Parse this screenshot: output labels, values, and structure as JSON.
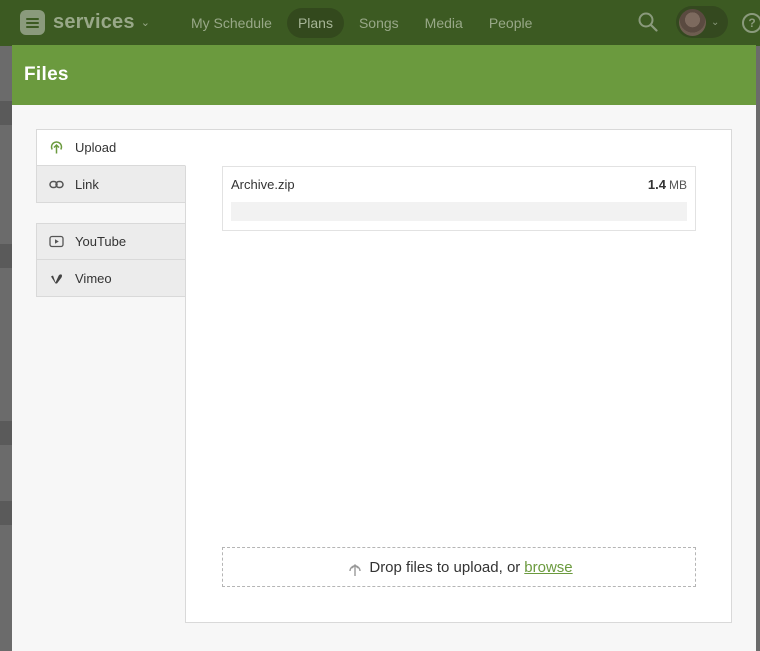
{
  "app": {
    "name": "services",
    "nav": [
      "My Schedule",
      "Plans",
      "Songs",
      "Media",
      "People"
    ],
    "active_nav": "Plans"
  },
  "modal": {
    "title": "Files",
    "tabs_group1": [
      {
        "label": "Upload",
        "icon": "upload-icon",
        "active": true
      },
      {
        "label": "Link",
        "icon": "link-icon",
        "active": false
      }
    ],
    "tabs_group2": [
      {
        "label": "YouTube",
        "icon": "youtube-icon",
        "active": false
      },
      {
        "label": "Vimeo",
        "icon": "vimeo-icon",
        "active": false
      }
    ],
    "file": {
      "name": "Archive.zip",
      "size_value": "1.4",
      "size_unit": "MB",
      "progress": 0
    },
    "dropzone": {
      "text": "Drop files to upload, or",
      "link": "browse"
    }
  },
  "colors": {
    "brand_green": "#6b9a3e",
    "topbar": "#3c5a22"
  }
}
